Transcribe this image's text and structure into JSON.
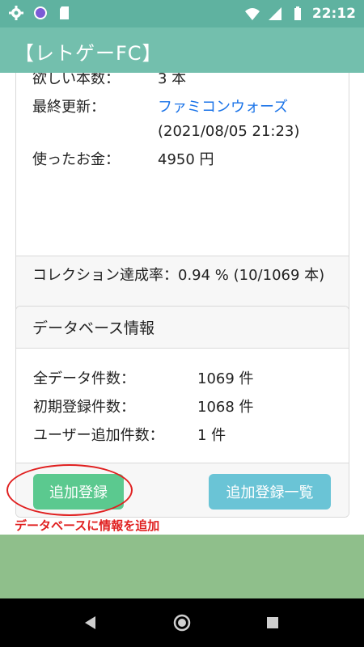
{
  "statusbar": {
    "time": "22:12"
  },
  "appbar": {
    "title": "【レトゲーFC】"
  },
  "stats": {
    "wanted_label": "欲しい本数：",
    "wanted_value": "3 本",
    "updated_label": "最終更新：",
    "updated_link": "ファミコンウォーズ",
    "updated_date": "(2021/08/05 21:23)",
    "spent_label": "使ったお金：",
    "spent_value": "4950 円",
    "rate_text": "コレクション達成率：0.94 % (10/1069 本)"
  },
  "database": {
    "title": "データベース情報",
    "rows": [
      {
        "label": "全データ件数：",
        "value": "1069 件"
      },
      {
        "label": "初期登録件数：",
        "value": "1068 件"
      },
      {
        "label": "ユーザー追加件数：",
        "value": "1 件"
      }
    ],
    "add_button": "追加登録",
    "list_button": "追加登録一覧"
  },
  "annotation": {
    "note": "データベースに情報を追加"
  },
  "colors": {
    "statusbar": "#5fb2a0",
    "appbar": "#73bfad",
    "add_button": "#5bc98f",
    "list_button": "#6ac4d6",
    "annotation": "#e02020"
  }
}
